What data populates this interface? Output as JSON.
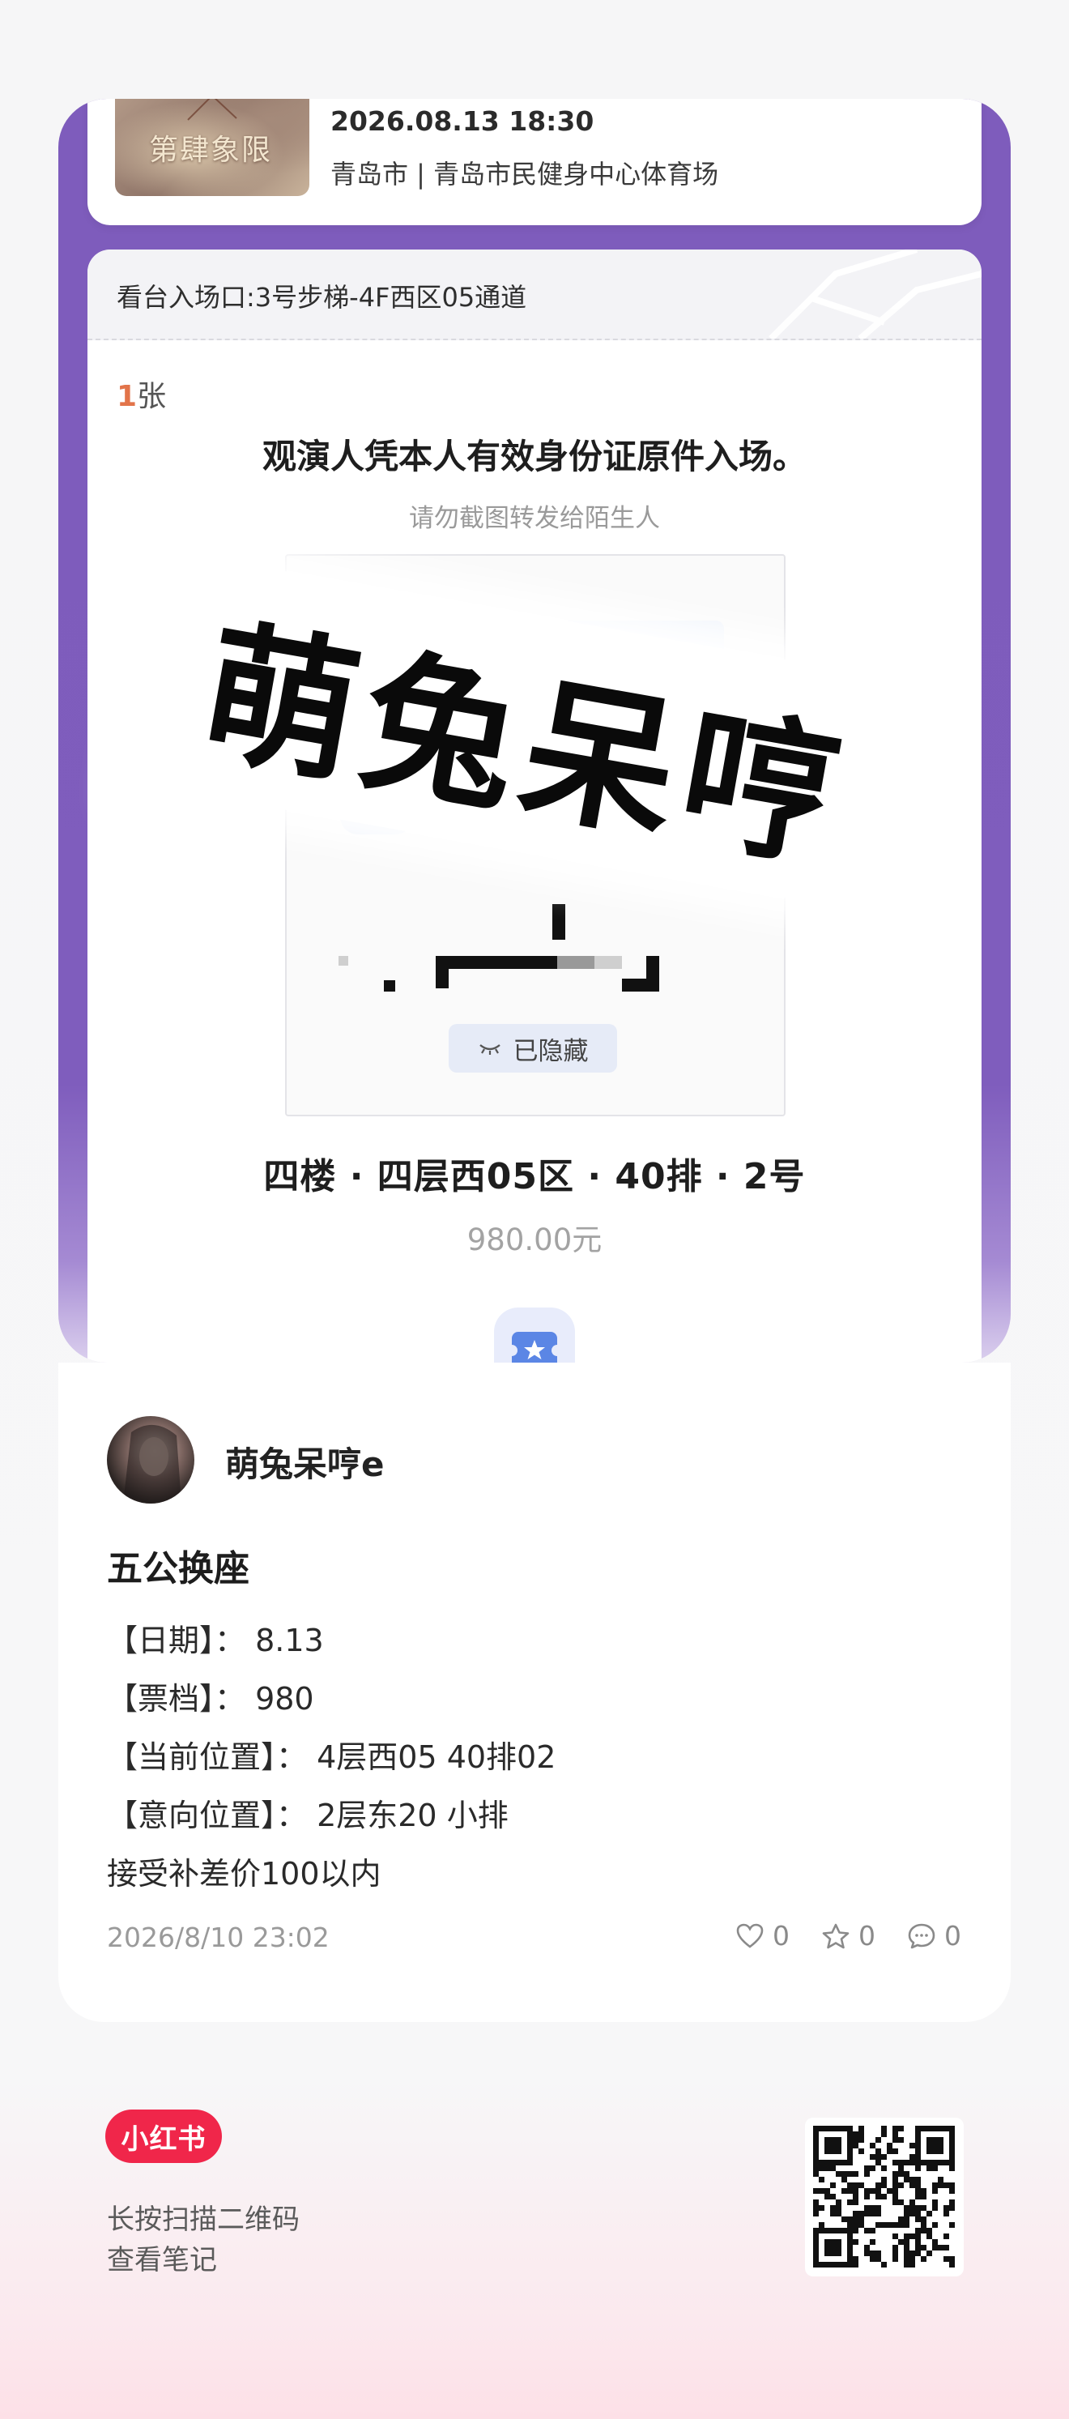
{
  "event": {
    "poster_title": "第肆象限",
    "datetime": "2026.08.13 18:30",
    "venue": "青岛市 | 青岛市民健身中心体育场"
  },
  "ticket": {
    "gate": "看台入场口:3号步梯-4F西区05通道",
    "qty_number": "1",
    "qty_unit": "张",
    "notice": "观演人凭本人有效身份证原件入场。",
    "warning": "请勿截图转发给陌生人",
    "hidden_label": "已隐藏",
    "seat": "四楼 · 四层西05区 · 40排 · 2号",
    "price": "980.00元"
  },
  "watermark": "萌兔呆哼",
  "note": {
    "username": "萌兔呆哼e",
    "title": "五公换座",
    "lines": [
      "【日期】： 8.13",
      "【票档】： 980",
      "【当前位置】： 4层西05 40排02",
      "【意向位置】： 2层东20 小排",
      "接受补差价100以内"
    ],
    "date": "2026/8/10 23:02",
    "likes": "0",
    "collects": "0",
    "comments": "0"
  },
  "footer": {
    "brand": "小红书",
    "line1": "长按扫描二维码",
    "line2": "查看笔记"
  },
  "colors": {
    "frame_purple": "#7e5cbc",
    "brand_red": "#f0264a",
    "qty_orange": "#e2744a"
  },
  "icons": [
    "heart-icon",
    "star-icon",
    "comment-icon",
    "closed-eye-icon",
    "ticket-icon",
    "qr-code-icon"
  ]
}
